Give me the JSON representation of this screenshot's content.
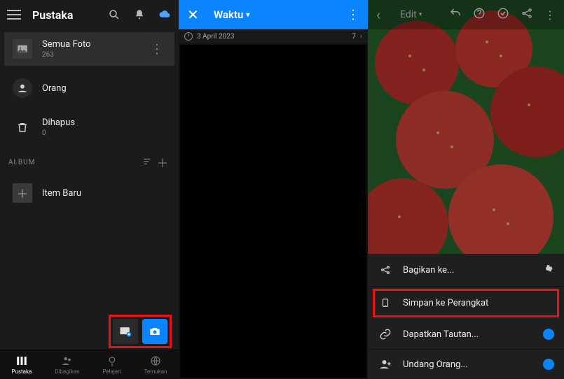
{
  "panel1": {
    "title": "Pustaka",
    "items": {
      "all_photos": {
        "label": "Semua Foto",
        "count": "263"
      },
      "people": {
        "label": "Orang"
      },
      "deleted": {
        "label": "Dihapus",
        "count": "0"
      }
    },
    "album_section": "ALBUM",
    "new_item": "Item Baru",
    "tabs": [
      "Pustaka",
      "Dibagikan",
      "Pelajari",
      "Temukan"
    ]
  },
  "panel2": {
    "title": "Waktu",
    "date": "3 April 2023",
    "count": "7"
  },
  "panel3": {
    "title": "Edit",
    "sheet": {
      "share": "Bagikan ke...",
      "save": "Simpan ke Perangkat",
      "link": "Dapatkan Tautan...",
      "invite": "Undang Orang..."
    }
  }
}
